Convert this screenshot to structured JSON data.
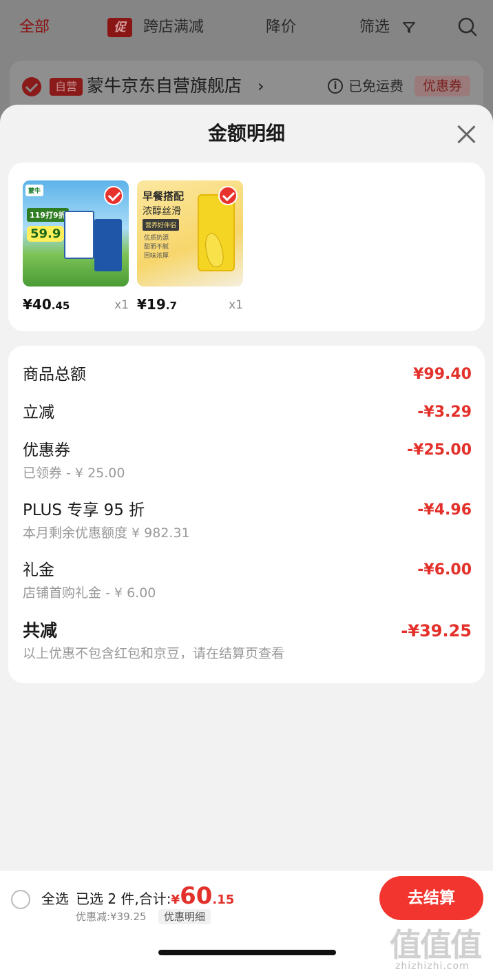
{
  "background": {
    "tabs": [
      {
        "label": "全部",
        "active": true
      },
      {
        "label": "跨店满减",
        "badge": "促"
      },
      {
        "label": "降价"
      },
      {
        "label": "筛选"
      }
    ],
    "store": {
      "self_badge": "自营",
      "name": "蒙牛京东自营旗舰店",
      "chevron": "›",
      "info_icon": "i",
      "shipping": "已免运费",
      "coupon": "优惠券"
    }
  },
  "sheet": {
    "title": "金额明细",
    "products": [
      {
        "price_main": "¥40",
        "price_cents": ".45",
        "qty": "x1",
        "image": {
          "logo": "蒙牛",
          "sticker": "119打9折",
          "price_tag": "59.9"
        }
      },
      {
        "price_main": "¥19",
        "price_cents": ".7",
        "qty": "x1",
        "image": {
          "title": "早餐搭配",
          "subtitle": "浓醇丝滑",
          "tag": "营养好伴侣",
          "bullets": [
            "优质奶源",
            "甜而不腻",
            "回味浓厚"
          ]
        }
      }
    ],
    "details": [
      {
        "label": "商品总额",
        "value": "¥99.40",
        "sub": ""
      },
      {
        "label": "立减",
        "value": "-¥3.29",
        "sub": ""
      },
      {
        "label": "优惠券",
        "value": "-¥25.00",
        "sub": "已领券 - ¥ 25.00"
      },
      {
        "label": "PLUS 专享 95 折",
        "value": "-¥4.96",
        "sub": "本月剩余优惠额度 ¥ 982.31"
      },
      {
        "label": "礼金",
        "value": "-¥6.00",
        "sub": "店铺首购礼金 - ¥ 6.00"
      }
    ],
    "total": {
      "label": "共减",
      "value": "-¥39.25",
      "note": "以上优惠不包含红包和京豆，请在结算页查看"
    }
  },
  "checkout": {
    "select_all": "全选",
    "selected_prefix": "已选 2 件,合计:",
    "currency": "¥",
    "total_main": "60",
    "total_cents": ".15",
    "discount_line": "优惠减:¥39.25",
    "detail_button": "优惠明细",
    "checkout_button": "去结算"
  },
  "watermark": {
    "logo": "值值值",
    "text": "zhizhizhi.com"
  },
  "colors": {
    "accent": "#e3302a",
    "checkout": "#f2362f"
  }
}
